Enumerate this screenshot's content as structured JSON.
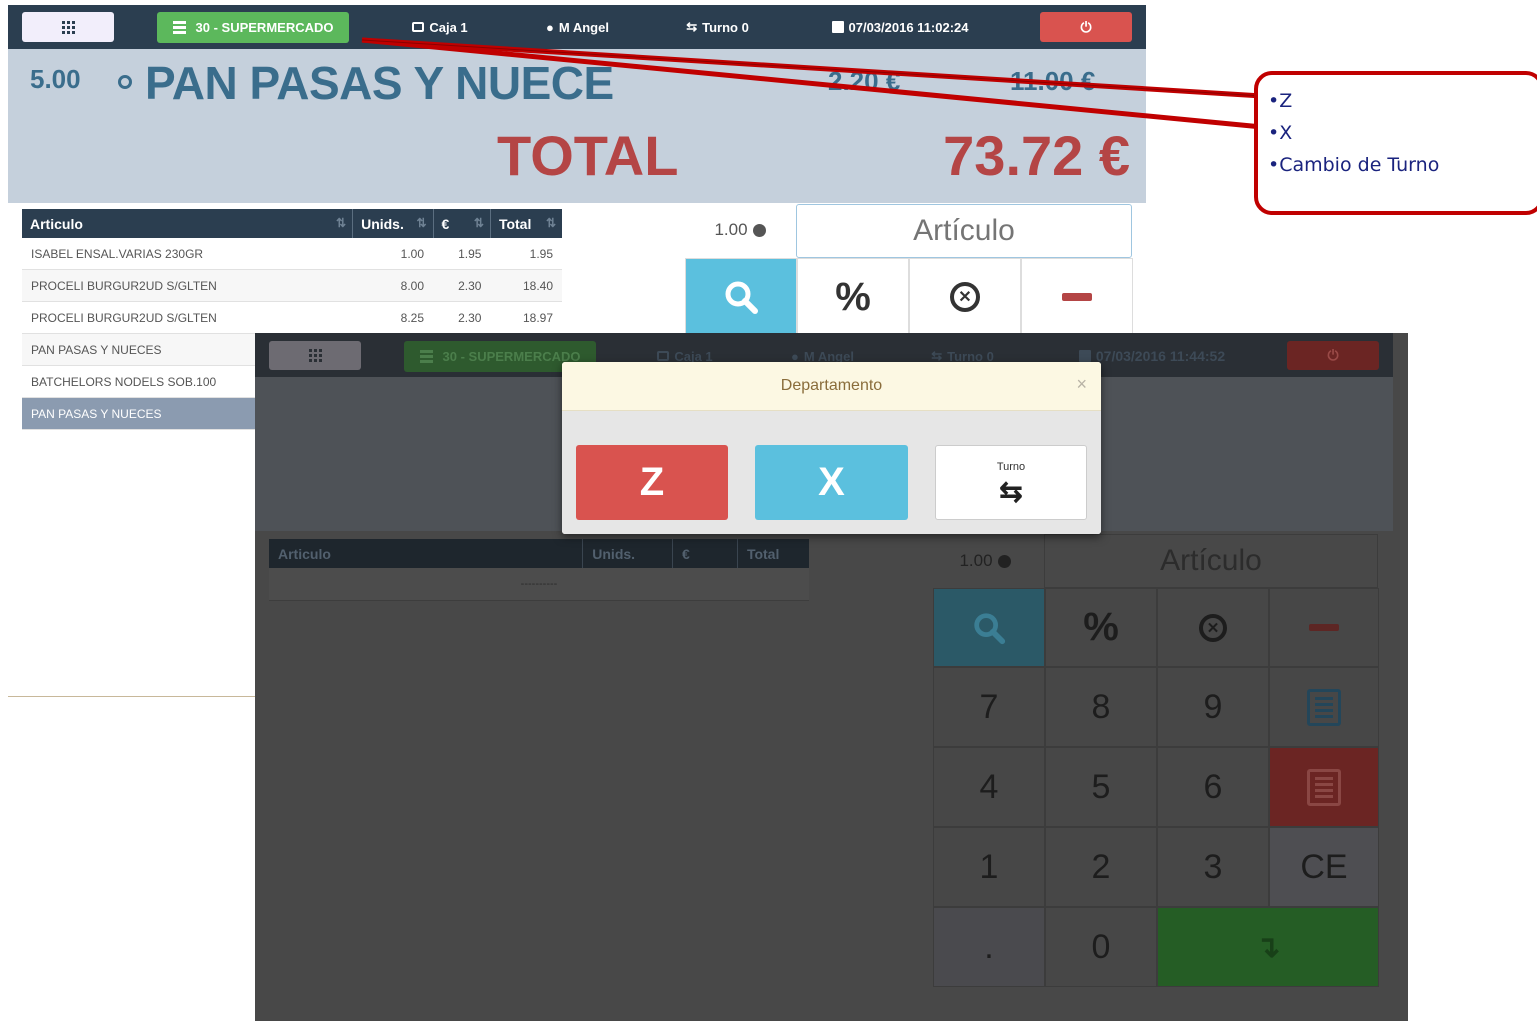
{
  "colors": {
    "accent": "#5bc0de",
    "brand": "#2b3e50",
    "danger": "#d9534f",
    "success": "#5cb85c",
    "callout": "#c00000"
  },
  "topbar": {
    "menu_icon": "grid-icon",
    "department_label": "30 - SUPERMERCADO",
    "caja_label": "Caja 1",
    "user_label": "M Angel",
    "turno_label": "Turno 0",
    "datetime": "07/03/2016 11:02:24",
    "power_icon": "power-icon"
  },
  "current_item": {
    "qty": "5.00",
    "name": "PAN PASAS Y NUECE",
    "price": "2.20 €",
    "subtotal": "11.00 €"
  },
  "total": {
    "label": "TOTAL",
    "value": "73.72 €"
  },
  "ticket": {
    "columns": [
      "Articulo",
      "Unids.",
      "€",
      "Total"
    ],
    "rows": [
      {
        "name": "ISABEL ENSAL.VARIAS 230GR",
        "units": "1.00",
        "price": "1.95",
        "total": "1.95"
      },
      {
        "name": "PROCELI BURGUR2UD S/GLTEN",
        "units": "8.00",
        "price": "2.30",
        "total": "18.40"
      },
      {
        "name": "PROCELI BURGUR2UD S/GLTEN",
        "units": "8.25",
        "price": "2.30",
        "total": "18.97"
      },
      {
        "name": "PAN PASAS Y NUECES",
        "units": "",
        "price": "",
        "total": ""
      },
      {
        "name": "BATCHELORS NODELS SOB.100",
        "units": "",
        "price": "",
        "total": ""
      },
      {
        "name": "PAN PASAS Y NUECES",
        "units": "",
        "price": "",
        "total": ""
      }
    ]
  },
  "keypad": {
    "qty_label": "1.00",
    "search_placeholder": "Artículo",
    "percent": "%"
  },
  "overlay": {
    "datetime": "07/03/2016 11:44:52",
    "department_label": "30 - SUPERMERCADO",
    "caja_label": "Caja 1",
    "user_label": "M Angel",
    "turno_label": "Turno 0",
    "qty_label": "1.00",
    "search_placeholder": "Artículo",
    "ticket_columns": [
      "Articulo",
      "Unids.",
      "€",
      "Total"
    ],
    "empty_row": "----------",
    "keys": {
      "k7": "7",
      "k8": "8",
      "k9": "9",
      "k4": "4",
      "k5": "5",
      "k6": "6",
      "k1": "1",
      "k2": "2",
      "k3": "3",
      "ce": "CE",
      "dot": ".",
      "k0": "0",
      "percent": "%"
    }
  },
  "modal": {
    "title": "Departamento",
    "close": "×",
    "z_label": "Z",
    "x_label": "X",
    "turno_label": "Turno"
  },
  "callout": {
    "items": [
      "•Z",
      "•X",
      "•Cambio de Turno"
    ]
  }
}
